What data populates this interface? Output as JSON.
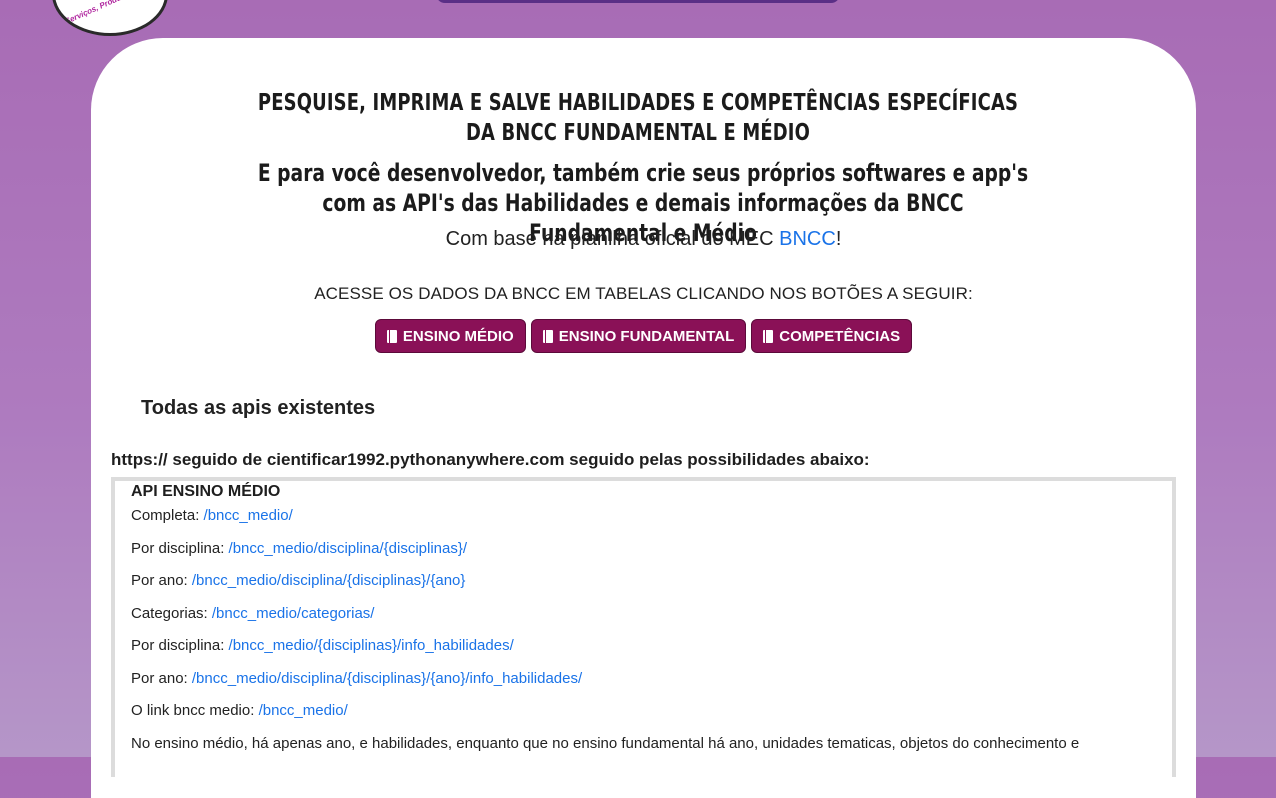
{
  "logo": {
    "text": "Serviços, Produtos e Informações"
  },
  "heading": {
    "line1": "PESQUISE, IMPRIMA E SALVE HABILIDADES E COMPETÊNCIAS ESPECÍFICAS DA BNCC FUNDAMENTAL E MÉDIO",
    "line2": "E para você desenvolvedor, também crie seus próprios softwares e app's com as API's das Habilidades e demais informações da BNCC Fundamental e Médio"
  },
  "base": {
    "text": "Com base na planilha oficial do MEC ",
    "link": "BNCC",
    "suffix": "!"
  },
  "access_text": "ACESSE OS DADOS DA BNCC EM TABELAS CLICANDO NOS BOTÕES A SEGUIR:",
  "buttons": [
    "ENSINO MÉDIO",
    "ENSINO FUNDAMENTAL",
    "COMPETÊNCIAS"
  ],
  "apis_title": "Todas as apis existentes",
  "https_text": "https:// seguido de cientificar1992.pythonanywhere.com seguido pelas possibilidades abaixo:",
  "api_box": {
    "title": "API ENSINO MÉDIO",
    "rows": [
      {
        "label": "Completa: ",
        "link": "/bncc_medio/"
      },
      {
        "label": "Por disciplina: ",
        "link": "/bncc_medio/disciplina/{disciplinas}/"
      },
      {
        "label": "Por ano: ",
        "link": "/bncc_medio/disciplina/{disciplinas}/{ano}"
      },
      {
        "label": "Categorias: ",
        "link": "/bncc_medio/categorias/"
      },
      {
        "label": "Por disciplina: ",
        "link": "/bncc_medio/{disciplinas}/info_habilidades/"
      },
      {
        "label": "Por ano: ",
        "link": "/bncc_medio/disciplina/{disciplinas}/{ano}/info_habilidades/"
      },
      {
        "label": "O link bncc medio: ",
        "link": "/bncc_medio/"
      }
    ],
    "note": "No ensino médio, há apenas ano, e habilidades, enquanto que no ensino fundamental há ano, unidades tematicas, objetos do conhecimento e"
  },
  "colors": {
    "background": "#a86cb5",
    "button": "#8a1157",
    "link": "#1a73e8"
  }
}
